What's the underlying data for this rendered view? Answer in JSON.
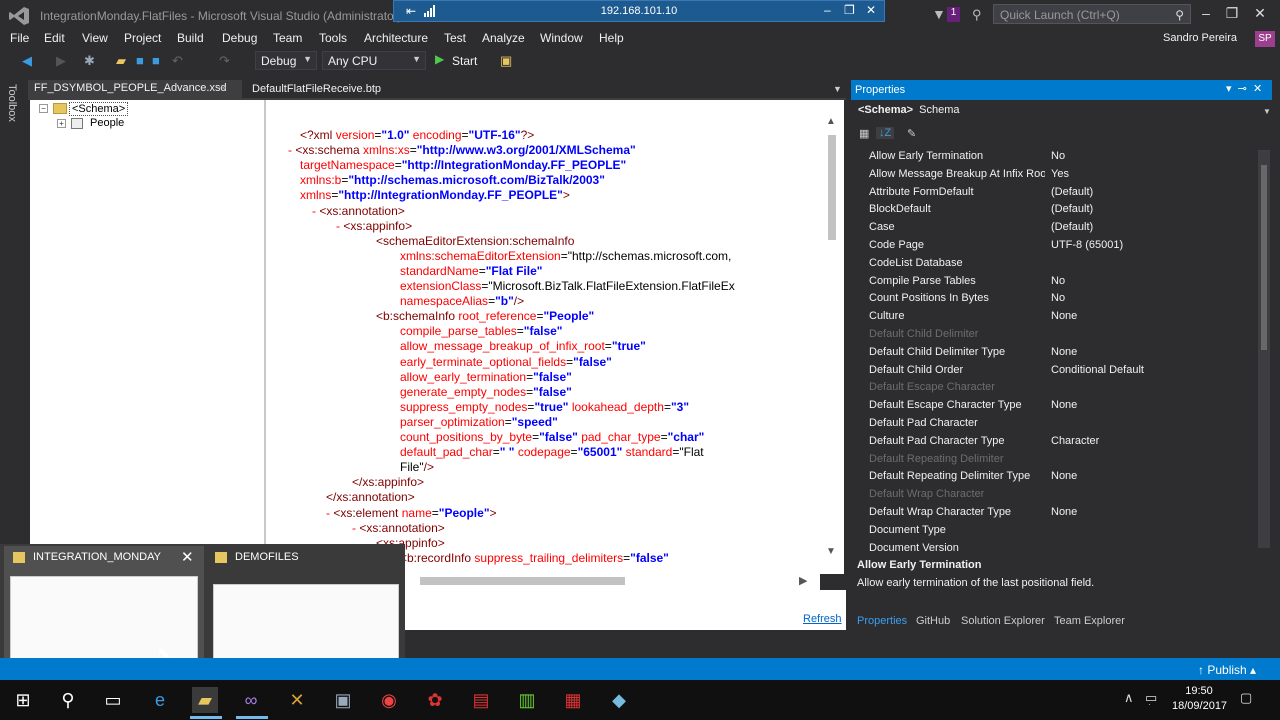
{
  "window": {
    "title": "IntegrationMonday.FlatFiles - Microsoft Visual Studio (Administrator)",
    "remote_ip": "192.168.101.10",
    "notification_count": "1",
    "quick_launch_placeholder": "Quick Launch (Ctrl+Q)",
    "user": "Sandro Pereira",
    "user_initials": "SP"
  },
  "menu": [
    "File",
    "Edit",
    "View",
    "Project",
    "Build",
    "Debug",
    "Team",
    "Tools",
    "Architecture",
    "Test",
    "Analyze",
    "Window",
    "Help"
  ],
  "toolbar": {
    "configuration": "Debug",
    "platform": "Any CPU",
    "start_label": "Start"
  },
  "toolbox_label": "Toolbox",
  "tabs": {
    "active": "FF_DSYMBOL_PEOPLE_Advance.xsd",
    "other": "DefaultFlatFileReceive.btp"
  },
  "schema_tree": {
    "root": "<Schema>",
    "child": "People"
  },
  "xml_lines": [
    "<?xml version=\"1.0\" encoding=\"UTF-16\"?>",
    "- <xs:schema xmlns:xs=\"http://www.w3.org/2001/XMLSchema\"",
    "targetNamespace=\"http://IntegrationMonday.FF_PEOPLE\"",
    "xmlns:b=\"http://schemas.microsoft.com/BizTalk/2003\"",
    "xmlns=\"http://IntegrationMonday.FF_PEOPLE\">",
    "- <xs:annotation>",
    "- <xs:appinfo>",
    "<schemaEditorExtension:schemaInfo",
    "xmlns:schemaEditorExtension=\"http://schemas.microsoft.com,",
    "standardName=\"Flat File\"",
    "extensionClass=\"Microsoft.BizTalk.FlatFileExtension.FlatFileEx",
    "namespaceAlias=\"b\"/>",
    "<b:schemaInfo root_reference=\"People\"",
    "compile_parse_tables=\"false\"",
    "allow_message_breakup_of_infix_root=\"true\"",
    "early_terminate_optional_fields=\"false\"",
    "allow_early_termination=\"false\"",
    "generate_empty_nodes=\"false\"",
    "suppress_empty_nodes=\"true\" lookahead_depth=\"3\"",
    "parser_optimization=\"speed\"",
    "count_positions_by_byte=\"false\" pad_char_type=\"char\"",
    "default_pad_char=\" \" codepage=\"65001\" standard=\"Flat",
    "File\"/>",
    "</xs:appinfo>",
    "</xs:annotation>",
    "- <xs:element name=\"People\">",
    "- <xs:annotation>",
    "<xs:appinfo>",
    "<b:recordInfo suppress_trailing_delimiters=\"false\""
  ],
  "refresh_label": "Refresh",
  "properties": {
    "title": "Properties",
    "selected_object": "<Schema>",
    "selected_type": "Schema",
    "rows": [
      {
        "key": "Allow Early Termination",
        "value": "No"
      },
      {
        "key": "Allow Message Breakup At Infix Roo",
        "value": "Yes"
      },
      {
        "key": "Attribute FormDefault",
        "value": "(Default)"
      },
      {
        "key": "BlockDefault",
        "value": "(Default)"
      },
      {
        "key": "Case",
        "value": "(Default)"
      },
      {
        "key": "Code Page",
        "value": "UTF-8 (65001)"
      },
      {
        "key": "CodeList Database",
        "value": ""
      },
      {
        "key": "Compile Parse Tables",
        "value": "No"
      },
      {
        "key": "Count Positions In Bytes",
        "value": "No"
      },
      {
        "key": "Culture",
        "value": "None"
      },
      {
        "key": "Default Child Delimiter",
        "value": ""
      },
      {
        "key": "Default Child Delimiter Type",
        "value": "None"
      },
      {
        "key": "Default Child Order",
        "value": "Conditional Default"
      },
      {
        "key": "Default Escape Character",
        "value": ""
      },
      {
        "key": "Default Escape Character Type",
        "value": "None"
      },
      {
        "key": "Default Pad Character",
        "value": ""
      },
      {
        "key": "Default Pad Character Type",
        "value": "Character"
      },
      {
        "key": "Default Repeating Delimiter",
        "value": ""
      },
      {
        "key": "Default Repeating Delimiter Type",
        "value": "None"
      },
      {
        "key": "Default Wrap Character",
        "value": ""
      },
      {
        "key": "Default Wrap Character Type",
        "value": "None"
      },
      {
        "key": "Document Type",
        "value": ""
      },
      {
        "key": "Document Version",
        "value": ""
      }
    ],
    "disabled_rows": [
      10,
      13,
      17,
      19
    ],
    "description_title": "Allow Early Termination",
    "description_text": "Allow early termination of the last positional field.",
    "bottom_tabs": [
      "Properties",
      "GitHub",
      "Solution Explorer",
      "Team Explorer"
    ]
  },
  "task_switcher": {
    "windows": [
      "INTEGRATION_MONDAY",
      "DEMOFILES"
    ]
  },
  "status": {
    "publish_label": "Publish"
  },
  "taskbar": {
    "time": "19:50",
    "date": "18/09/2017"
  }
}
